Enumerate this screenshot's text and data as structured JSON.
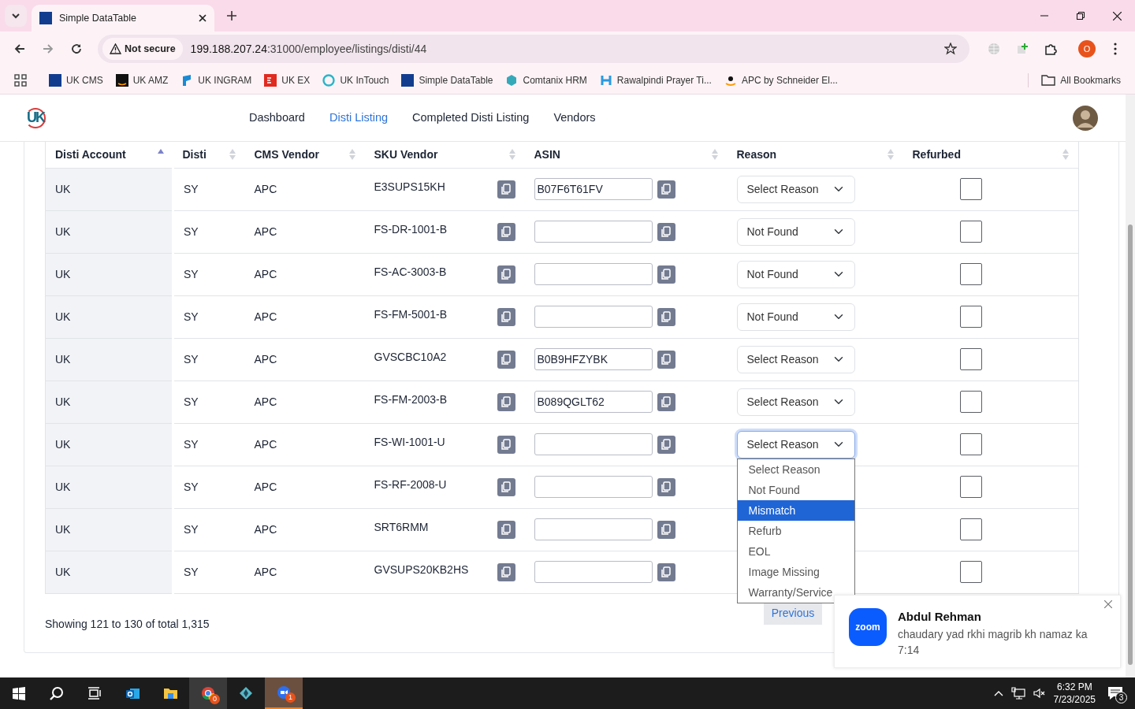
{
  "browser": {
    "tabs": [
      {
        "title": "Simple DataTable",
        "selected": true
      }
    ],
    "address": {
      "security": "Not secure",
      "host": "199.188.207.24",
      "path": ":31000/employee/listings/disti/44"
    },
    "bookmarks": [
      {
        "label": "UK CMS",
        "kind": "df"
      },
      {
        "label": "UK AMZ",
        "kind": "amazon"
      },
      {
        "label": "UK INGRAM",
        "kind": "ingram"
      },
      {
        "label": "UK EX",
        "kind": "ex"
      },
      {
        "label": "UK InTouch",
        "kind": "ring"
      },
      {
        "label": "Simple DataTable",
        "kind": "df"
      },
      {
        "label": "Comtanix HRM",
        "kind": "hex"
      },
      {
        "label": "Rawalpindi Prayer Ti...",
        "kind": "h"
      },
      {
        "label": "APC by Schneider El...",
        "kind": "amazon-plain"
      }
    ],
    "all_bookmarks": "All Bookmarks",
    "profile": "O"
  },
  "app": {
    "logo": "UK",
    "nav": [
      {
        "label": "Dashboard",
        "selected": false
      },
      {
        "label": "Disti Listing",
        "selected": true
      },
      {
        "label": "Completed Disti Listing",
        "selected": false
      },
      {
        "label": "Vendors",
        "selected": false
      }
    ],
    "table": {
      "columns": [
        {
          "label": "Disti Account",
          "sorted": true
        },
        {
          "label": "Disti",
          "sorted": false
        },
        {
          "label": "CMS Vendor",
          "sorted": false
        },
        {
          "label": "SKU Vendor",
          "sorted": false
        },
        {
          "label": "ASIN",
          "sorted": false
        },
        {
          "label": "Reason",
          "sorted": false
        },
        {
          "label": "Refurbed",
          "sorted": false
        }
      ],
      "rows": [
        {
          "disti_account": "UK",
          "disti": "SY",
          "cms_vendor": "APC",
          "sku_vendor": "E3SUPS15KH",
          "asin": "B07F6T61FV",
          "reason": "Select Reason",
          "focused": false,
          "refurbed": false
        },
        {
          "disti_account": "UK",
          "disti": "SY",
          "cms_vendor": "APC",
          "sku_vendor": "FS-DR-1001-B",
          "reason": "Not Found",
          "focused": false,
          "refurbed": false
        },
        {
          "disti_account": "UK",
          "disti": "SY",
          "cms_vendor": "APC",
          "sku_vendor": "FS-AC-3003-B",
          "reason": "Not Found",
          "focused": false,
          "refurbed": false
        },
        {
          "disti_account": "UK",
          "disti": "SY",
          "cms_vendor": "APC",
          "sku_vendor": "FS-FM-5001-B",
          "reason": "Not Found",
          "focused": false,
          "refurbed": false
        },
        {
          "disti_account": "UK",
          "disti": "SY",
          "cms_vendor": "APC",
          "sku_vendor": "GVSCBC10A2",
          "asin": "B0B9HFZYBK",
          "reason": "Select Reason",
          "focused": false,
          "refurbed": false
        },
        {
          "disti_account": "UK",
          "disti": "SY",
          "cms_vendor": "APC",
          "sku_vendor": "FS-FM-2003-B",
          "asin": "B089QGLT62",
          "reason": "Select Reason",
          "focused": false,
          "refurbed": false
        },
        {
          "disti_account": "UK",
          "disti": "SY",
          "cms_vendor": "APC",
          "sku_vendor": "FS-WI-1001-U",
          "reason": "Select Reason",
          "focused": true,
          "refurbed": false,
          "menu_options": [
            {
              "label": "Select Reason",
              "selected": false
            },
            {
              "label": "Not Found",
              "selected": false
            },
            {
              "label": "Mismatch",
              "selected": true
            },
            {
              "label": "Refurb",
              "selected": false
            },
            {
              "label": "EOL",
              "selected": false
            },
            {
              "label": "Image Missing",
              "selected": false
            },
            {
              "label": "Warranty/Service",
              "selected": false
            }
          ]
        },
        {
          "disti_account": "UK",
          "disti": "SY",
          "cms_vendor": "APC",
          "sku_vendor": "FS-RF-2008-U",
          "refurbed": false
        },
        {
          "disti_account": "UK",
          "disti": "SY",
          "cms_vendor": "APC",
          "sku_vendor": "SRT6RMM",
          "refurbed": false
        },
        {
          "disti_account": "UK",
          "disti": "SY",
          "cms_vendor": "APC",
          "sku_vendor": "GVSUPS20KB2HS",
          "refurbed": false
        }
      ]
    },
    "summary": "Showing 121 to 130 of total 1,315",
    "previous": "Previous"
  },
  "notification": {
    "app_logo": "zoom",
    "sender": "Abdul Rehman",
    "message": "chaudary yad rkhi magrib kh namaz ka 7:14"
  },
  "taskbar": {
    "apps": [
      {
        "kind": "start",
        "selected": false
      },
      {
        "kind": "search",
        "selected": false
      },
      {
        "kind": "taskview",
        "selected": false
      },
      {
        "kind": "outlook",
        "selected": false
      },
      {
        "kind": "folder",
        "selected": false
      },
      {
        "kind": "chrome",
        "selected": true,
        "badge": "0"
      },
      {
        "kind": "gem",
        "selected": false
      },
      {
        "kind": "zoom",
        "selected": false,
        "attention": true,
        "badge": "1"
      }
    ],
    "time": "6:32 PM",
    "date": "7/23/2025",
    "notifications": "3"
  }
}
